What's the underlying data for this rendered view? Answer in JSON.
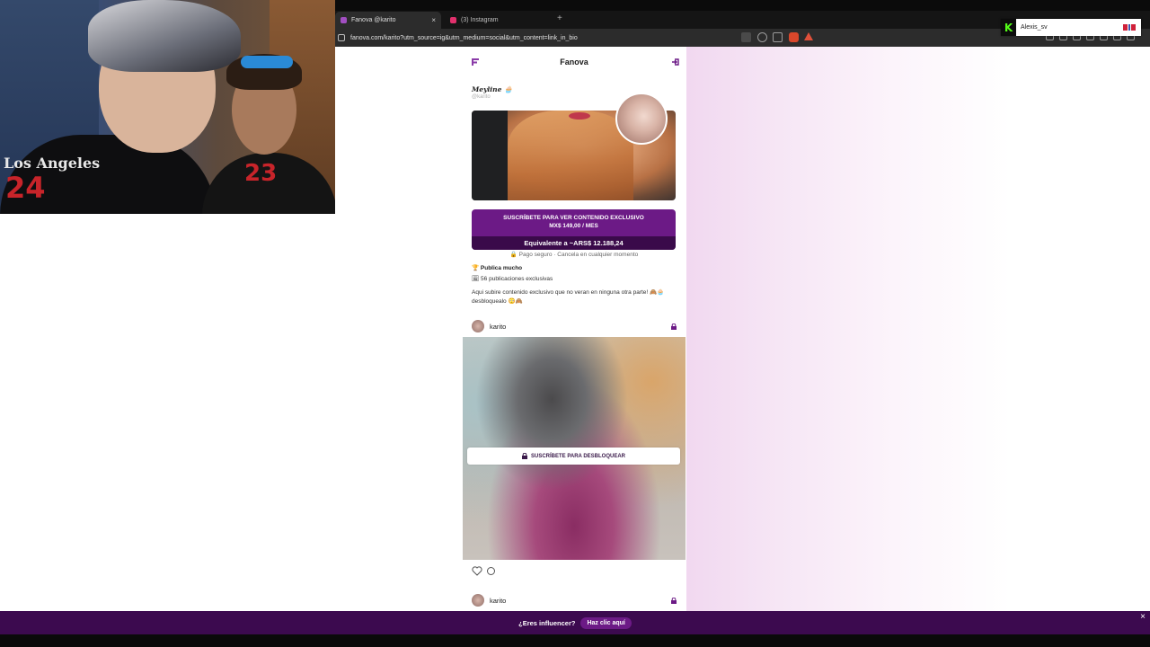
{
  "browser": {
    "tabs": [
      {
        "label": "Fanova @karito",
        "active": true
      },
      {
        "label": "(3) Instagram",
        "active": false
      }
    ],
    "new_tab_symbol": "+",
    "address": "fanova.com/karito?utm_source=ig&utm_medium=social&utm_content=link_in_bio"
  },
  "stream_overlay": {
    "username": "Alexis_sv",
    "logo_letter": "K",
    "brand_color": "#53fc18",
    "shirt_left_text": "Los Angeles",
    "shirt_left_number": "24",
    "shirt_right_number": "23"
  },
  "app": {
    "title": "Fanova",
    "accent_color": "#6c1a86",
    "creator": {
      "display_name": "Meyline 🧁",
      "handle": "@karito"
    },
    "subscribe": {
      "line1": "SUSCRÍBETE PARA VER CONTENIDO EXCLUSIVO",
      "line2": "MX$ 149,00 / MES",
      "equivalent": "Equivalente a ~ARS$ 12.188,24"
    },
    "secure_note": "🔒 Pago seguro · Cancela en cualquier momento",
    "stats": {
      "frequency": "🏆 Publica mucho",
      "posts": "🖼 56 publicaciones exclusivas"
    },
    "bio": "Aqui subire contenido exclusivo que no veran en ninguna otra parte! 🙈🧁 desbloquealo 😳🙈",
    "posts": [
      {
        "user": "karito",
        "locked": true,
        "unlock_label": "SUSCRÍBETE PARA DESBLOQUEAR"
      },
      {
        "user": "karito",
        "locked": true
      }
    ]
  },
  "banner": {
    "question": "¿Eres influencer?",
    "cta": "Haz clic aquí",
    "close_symbol": "×"
  }
}
